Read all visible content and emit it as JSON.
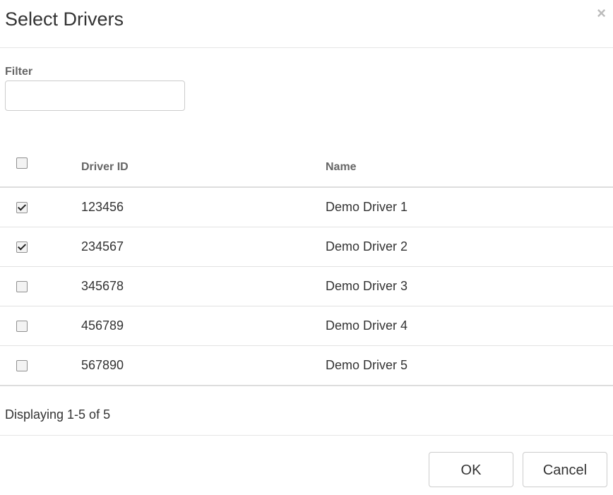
{
  "dialog": {
    "title": "Select Drivers",
    "close_symbol": "×"
  },
  "filter": {
    "label": "Filter",
    "value": "",
    "placeholder": ""
  },
  "table": {
    "columns": [
      "Driver ID",
      "Name"
    ],
    "header_checked": false,
    "rows": [
      {
        "checked": true,
        "id": "123456",
        "name": "Demo Driver 1"
      },
      {
        "checked": true,
        "id": "234567",
        "name": "Demo Driver 2"
      },
      {
        "checked": false,
        "id": "345678",
        "name": "Demo Driver 3"
      },
      {
        "checked": false,
        "id": "456789",
        "name": "Demo Driver 4"
      },
      {
        "checked": false,
        "id": "567890",
        "name": "Demo Driver 5"
      }
    ]
  },
  "pager": {
    "text": "Displaying 1-5 of 5"
  },
  "buttons": {
    "ok": "OK",
    "cancel": "Cancel"
  }
}
